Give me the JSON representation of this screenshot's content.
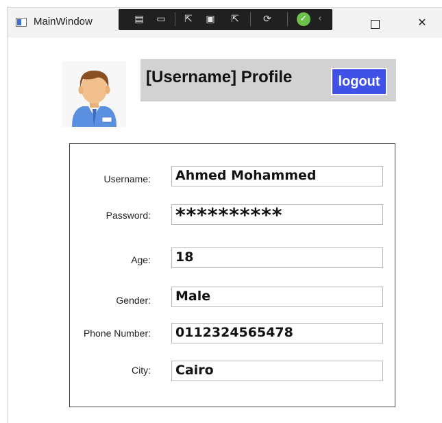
{
  "window": {
    "title": "MainWindow"
  },
  "debug_toolbar": {
    "icons": [
      "live-visual-tree-icon",
      "record-icon",
      "select-element-icon",
      "display-layout-adorners-icon",
      "track-focus-icon",
      "hot-reload-icon",
      "binding-ok-icon",
      "collapse-icon"
    ]
  },
  "header": {
    "title": "[Username] Profile",
    "logout_label": "logout",
    "accent": "#3f51e6",
    "panel_color": "#d2d2d2"
  },
  "form": {
    "fields": [
      {
        "label": "Username:",
        "value": "Ahmed Mohammed"
      },
      {
        "label": "Password:",
        "value": "**********"
      },
      {
        "label": "Age:",
        "value": "18"
      },
      {
        "label": "Gender:",
        "value": "Male"
      },
      {
        "label": "Phone Number:",
        "value": "0112324565478"
      },
      {
        "label": "City:",
        "value": "Cairo"
      }
    ]
  }
}
